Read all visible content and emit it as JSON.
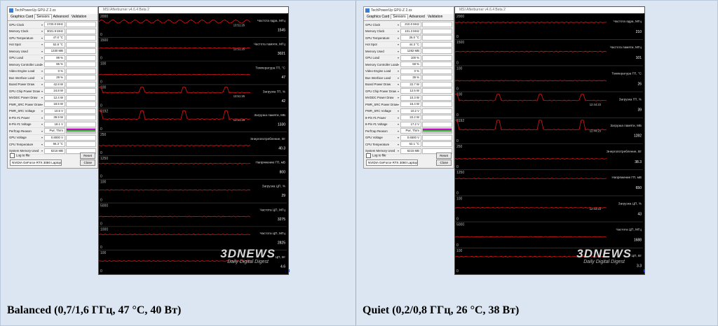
{
  "panels": [
    {
      "caption": "Balanced (0,7/1,6 ГГц, 47 °C, 40 Вт)",
      "gpuz": {
        "title": "TechPowerUp GPU-Z 2.xx",
        "tabs": [
          "Graphics Card",
          "Sensors",
          "Advanced",
          "Validation"
        ],
        "active_tab": 1,
        "sensors": [
          {
            "label": "GPU Clock",
            "value": "1720.0 MHz",
            "bar": "flat"
          },
          {
            "label": "Memory Clock",
            "value": "3021.9 MHz",
            "bar": "flat"
          },
          {
            "label": "GPU Temperature",
            "value": "47.0 °C",
            "bar": "flat"
          },
          {
            "label": "Hot Spot",
            "value": "52.8 °C",
            "bar": "flat"
          },
          {
            "label": "Memory Used",
            "value": "1330 MB",
            "bar": "flat"
          },
          {
            "label": "GPU Load",
            "value": "99 %",
            "bar": "spiky"
          },
          {
            "label": "Memory Controller Load",
            "value": "86 %",
            "bar": "spiky"
          },
          {
            "label": "Video Engine Load",
            "value": "0 %",
            "bar": "none"
          },
          {
            "label": "Bus Interface Load",
            "value": "29 %",
            "bar": "flat"
          },
          {
            "label": "Board Power Draw",
            "value": "42.8 W",
            "bar": "flat"
          },
          {
            "label": "GPU Chip Power Draw",
            "value": "24.8 W",
            "bar": "flat"
          },
          {
            "label": "MVDDC Power Draw",
            "value": "12.4 W",
            "bar": "flat"
          },
          {
            "label": "PWR_SRC Power Draw",
            "value": "18.5 W",
            "bar": "flat"
          },
          {
            "label": "PWR_SRC Voltage",
            "value": "10.5 V",
            "bar": "flat"
          },
          {
            "label": "8-Pin #1 Power",
            "value": "39.9 W",
            "bar": "flat"
          },
          {
            "label": "8-Pin #1 Voltage",
            "value": "18.1 V",
            "bar": "flat"
          },
          {
            "label": "PerfCap Reason",
            "value": "Pwr, Thrm",
            "bar": "perf"
          },
          {
            "label": "GPU Voltage",
            "value": "0.8000 V",
            "bar": "none"
          },
          {
            "label": "CPU Temperature",
            "value": "66.3 °C",
            "bar": "flat"
          },
          {
            "label": "System Memory Used",
            "value": "6216 MB",
            "bar": "flat"
          }
        ],
        "log_label": "Log to file",
        "reset_label": "Reset",
        "device_select": "NVIDIA GeForce RTX 3080 Laptop GPU",
        "close_label": "Close"
      },
      "afterburner": {
        "title": "MSI Afterburner v4.6.4 Beta 2",
        "graphs": [
          {
            "label": "Частота ядра, МГц",
            "ytop": "2000",
            "ybot": "0",
            "cur": "1545",
            "time": "13:51:26"
          },
          {
            "label": "Частота памяти, МГц",
            "ytop": "1500",
            "ybot": "0",
            "cur": "3021",
            "time": "13:51:26"
          },
          {
            "label": "Температура ГП, °С",
            "ytop": "100",
            "ybot": "0",
            "cur": "47",
            "time": ""
          },
          {
            "label": "Загрузка ГП, %",
            "ytop": "100",
            "ybot": "0",
            "cur": "42",
            "time": "13:51:26"
          },
          {
            "label": "Загрузка памяти, МБ",
            "ytop": "8192",
            "ybot": "0",
            "cur": "1330",
            "time": "13:51:29"
          },
          {
            "label": "Энергопотребление, Вт",
            "ytop": "250",
            "ybot": "0",
            "cur": "40.3",
            "time": ""
          },
          {
            "label": "Напряжение ГП, мВ",
            "ytop": "1250",
            "ybot": "0",
            "cur": "800",
            "time": ""
          },
          {
            "label": "Загрузка ЦП, %",
            "ytop": "100",
            "ybot": "0",
            "cur": "29",
            "time": ""
          },
          {
            "label": "Частота ЦП, МГц",
            "ytop": "5000",
            "ybot": "0",
            "cur": "3275",
            "time": ""
          },
          {
            "label": "Частота ЦП, МГц",
            "ytop": "1000",
            "ybot": "0",
            "cur": "2825",
            "time": ""
          },
          {
            "label": "ЦП, Вт",
            "ytop": "100",
            "ybot": "0",
            "cur": "4.6",
            "time": ""
          }
        ],
        "watermark_big": "3DNEWS",
        "watermark_small": "Daily Digital Digest"
      }
    },
    {
      "caption": "Quiet (0,2/0,8 ГГц, 26 °C, 38 Вт)",
      "gpuz": {
        "title": "TechPowerUp GPU-Z 2.xx",
        "tabs": [
          "Graphics Card",
          "Sensors",
          "Advanced",
          "Validation"
        ],
        "active_tab": 1,
        "sensors": [
          {
            "label": "GPU Clock",
            "value": "210.0 MHz",
            "bar": "flat"
          },
          {
            "label": "Memory Clock",
            "value": "101.3 MHz",
            "bar": "flat"
          },
          {
            "label": "GPU Temperature",
            "value": "26.0 °C",
            "bar": "flat"
          },
          {
            "label": "Hot Spot",
            "value": "44.3 °C",
            "bar": "flat"
          },
          {
            "label": "Memory Used",
            "value": "1282 MB",
            "bar": "flat"
          },
          {
            "label": "GPU Load",
            "value": "100 %",
            "bar": "spiky"
          },
          {
            "label": "Memory Controller Load",
            "value": "68 %",
            "bar": "spiky"
          },
          {
            "label": "Video Engine Load",
            "value": "0 %",
            "bar": "none"
          },
          {
            "label": "Bus Interface Load",
            "value": "39 %",
            "bar": "flat"
          },
          {
            "label": "Board Power Draw",
            "value": "22.7 W",
            "bar": "flat"
          },
          {
            "label": "GPU Chip Power Draw",
            "value": "12.5 W",
            "bar": "flat"
          },
          {
            "label": "MVDDC Power Draw",
            "value": "10.3 W",
            "bar": "flat"
          },
          {
            "label": "PWR_SRC Power Draw",
            "value": "16.4 W",
            "bar": "flat"
          },
          {
            "label": "PWR_SRC Voltage",
            "value": "10.2 V",
            "bar": "flat"
          },
          {
            "label": "8-Pin #1 Power",
            "value": "22.2 W",
            "bar": "flat"
          },
          {
            "label": "8-Pin #1 Voltage",
            "value": "17.2 V",
            "bar": "flat"
          },
          {
            "label": "PerfCap Reason",
            "value": "Pwr, Thrm",
            "bar": "perf"
          },
          {
            "label": "GPU Voltage",
            "value": "0.6500 V",
            "bar": "none"
          },
          {
            "label": "CPU Temperature",
            "value": "62.1 °C",
            "bar": "flat"
          },
          {
            "label": "System Memory Used",
            "value": "6215 MB",
            "bar": "flat"
          }
        ],
        "log_label": "Log to file",
        "reset_label": "Reset",
        "device_select": "NVIDIA GeForce RTX 3080 Laptop GPU",
        "close_label": "Close"
      },
      "afterburner": {
        "title": "MSI Afterburner v4.6.4 Beta 2",
        "graphs": [
          {
            "label": "Частота ядра, МГц",
            "ytop": "2000",
            "ybot": "0",
            "cur": "210",
            "time": ""
          },
          {
            "label": "Частота памяти, МГц",
            "ytop": "1500",
            "ybot": "0",
            "cur": "101",
            "time": ""
          },
          {
            "label": "Температура ГП, °С",
            "ytop": "100",
            "ybot": "0",
            "cur": "26",
            "time": ""
          },
          {
            "label": "Загрузка ГП, %",
            "ytop": "100",
            "ybot": "0",
            "cur": "39",
            "time": "12:44:23"
          },
          {
            "label": "Загрузка памяти, МБ",
            "ytop": "8192",
            "ybot": "0",
            "cur": "1282",
            "time": "12:44:23"
          },
          {
            "label": "Энергопотребление, Вт",
            "ytop": "250",
            "ybot": "0",
            "cur": "38.3",
            "time": ""
          },
          {
            "label": "Напряжение ГП, мВ",
            "ytop": "1250",
            "ybot": "0",
            "cur": "650",
            "time": ""
          },
          {
            "label": "Загрузка ЦП, %",
            "ytop": "100",
            "ybot": "0",
            "cur": "43",
            "time": "12:44:23"
          },
          {
            "label": "Частота ЦП, МГц",
            "ytop": "5000",
            "ybot": "0",
            "cur": "1688",
            "time": ""
          },
          {
            "label": "ЦП, Вт",
            "ytop": "100",
            "ybot": "0",
            "cur": "3.3",
            "time": ""
          }
        ],
        "watermark_big": "3DNEWS",
        "watermark_small": "Daily Digital Digest"
      }
    }
  ]
}
